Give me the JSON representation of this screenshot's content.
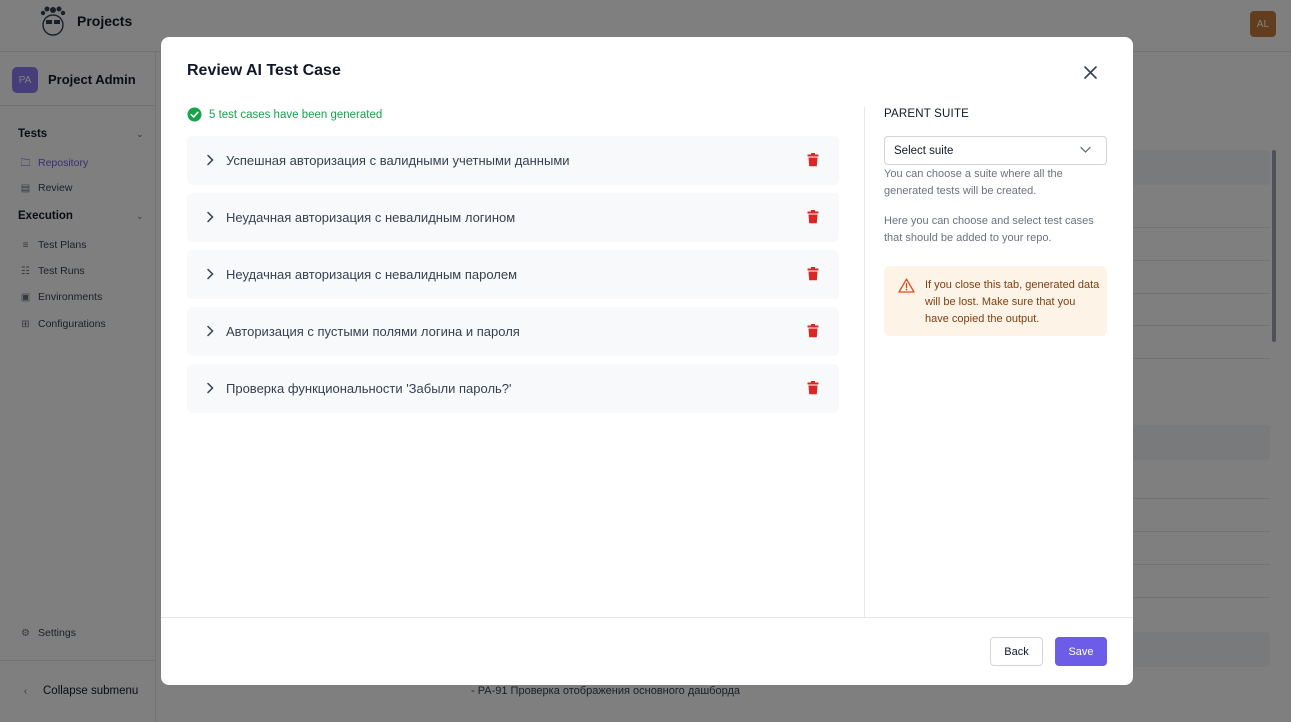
{
  "topbar": {
    "title": "Projects",
    "user_initials": "AL"
  },
  "sidebar": {
    "project_initials": "PA",
    "project_name": "Project Admin",
    "sections": [
      {
        "label": "Tests"
      },
      {
        "label": "Execution"
      }
    ],
    "items": [
      {
        "label": "Repository",
        "icon": "folder-icon"
      },
      {
        "label": "Review",
        "icon": "review-icon"
      },
      {
        "label": "Test Plans",
        "icon": "list-icon"
      },
      {
        "label": "Test Runs",
        "icon": "clipboard-icon"
      },
      {
        "label": "Environments",
        "icon": "environment-icon"
      },
      {
        "label": "Configurations",
        "icon": "sliders-icon"
      }
    ],
    "settings_label": "Settings",
    "collapse_label": "Collapse submenu"
  },
  "background": {
    "bottom_row_text": "PA-91 Проверка отображения основного дашборда"
  },
  "modal": {
    "title": "Review AI Test Case",
    "success_message": "5 test cases have been generated",
    "test_cases": [
      {
        "title": "Успешная авторизация с валидными учетными данными"
      },
      {
        "title": "Неудачная авторизация с невалидным логином"
      },
      {
        "title": "Неудачная авторизация с невалидным паролем"
      },
      {
        "title": "Авторизация с пустыми полями логина и пароля"
      },
      {
        "title": "Проверка функциональности 'Забыли пароль?'"
      }
    ],
    "parent_suite": {
      "label": "PARENT SUITE",
      "select_value": "Select suite",
      "helper_1": "You can choose a suite where all the generated tests will be created.",
      "helper_2": "Here you can choose and select test cases that should be added to your repo."
    },
    "warning": "If you close this tab, generated data will be lost. Make sure that you have copied the output.",
    "buttons": {
      "back": "Back",
      "save": "Save"
    }
  },
  "colors": {
    "accent": "#6d5ce7",
    "success": "#16a34a",
    "danger": "#dc2626",
    "warning_bg": "#fef3e7",
    "warning_icon": "#dc4a26"
  }
}
